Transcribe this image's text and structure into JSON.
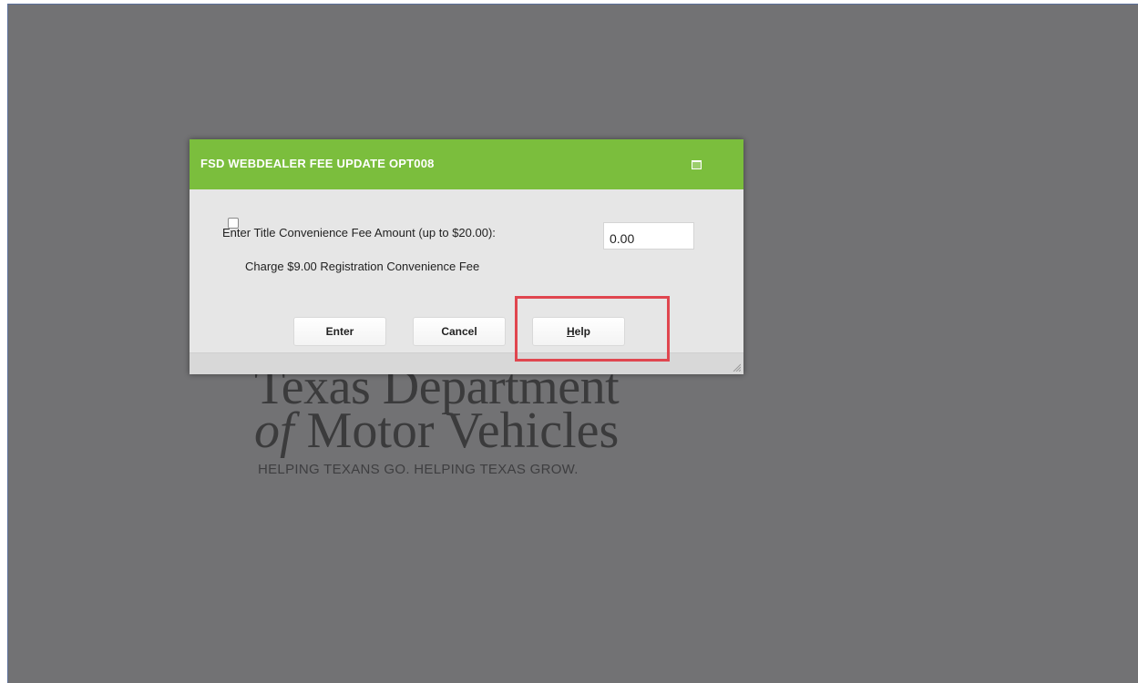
{
  "logo": {
    "line1": "Texas Department",
    "line2_of": "of",
    "line2_rest": " Motor Vehicles",
    "tagline": "HELPING TEXANS GO. HELPING TEXAS GROW."
  },
  "dialog": {
    "title": "FSD WEBDEALER FEE UPDATE OPT008",
    "maximize_icon": "maximize-icon",
    "fee_label": "Enter Title Convenience Fee Amount (up to $20.00):",
    "fee_value": "0.00",
    "registration_fee_label": "Charge $9.00 Registration Convenience Fee",
    "registration_fee_checked": false,
    "buttons": {
      "enter": "Enter",
      "cancel": "Cancel",
      "help_hotkey": "H",
      "help_rest": "elp"
    },
    "resize_icon": "resize-grip-icon"
  },
  "colors": {
    "header_green": "#7bbe3d",
    "overlay_gray": "#727274",
    "highlight_red": "#e0464f"
  }
}
